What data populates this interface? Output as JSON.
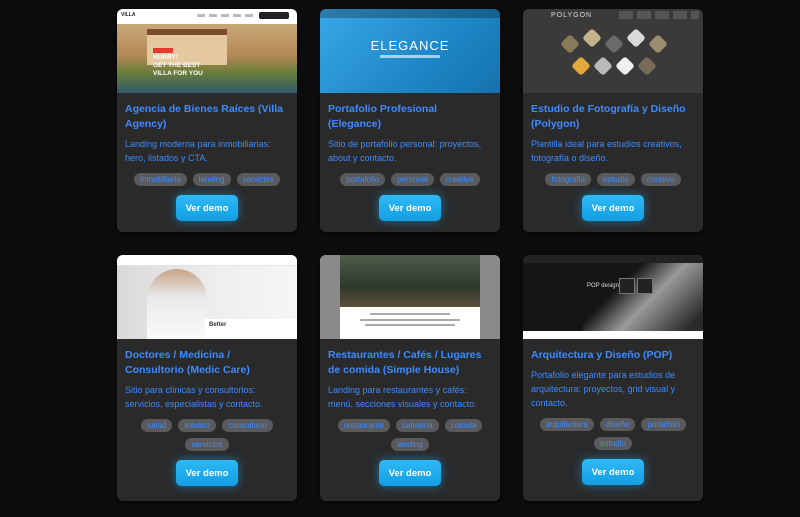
{
  "cards": [
    {
      "title": "Agencia de Bienes Raíces (Villa Agency)",
      "description": "Landing moderna para inmobiliarias: hero, listados y CTA.",
      "tags": [
        "inmobiliaria",
        "landing",
        "servicios"
      ],
      "button": "Ver demo",
      "thumb": {
        "logo": "VILLA",
        "hero_text": "HURRY!\nGET THE BEST\nVILLA FOR YOU"
      }
    },
    {
      "title": "Portafolio Profesional (Elegance)",
      "description": "Sitio de portafolio personal: proyectos, about y contacto.",
      "tags": [
        "portafolio",
        "personal",
        "creativo"
      ],
      "button": "Ver demo",
      "thumb": {
        "hero_text": "ELEGANCE"
      }
    },
    {
      "title": "Estudio de Fotografía y Diseño (Polygon)",
      "description": "Plantilla ideal para estudios creativos, fotografía o diseño.",
      "tags": [
        "fotografia",
        "estudio",
        "creativo"
      ],
      "button": "Ver demo",
      "thumb": {
        "logo": "POLYGON"
      }
    },
    {
      "title": "Doctores / Medicina / Consultorio (Medic Care)",
      "description": "Sitio para clínicas y consultorios: servicios, especialistas y contacto.",
      "tags": [
        "salud",
        "medico",
        "consultorio",
        "servicios"
      ],
      "button": "Ver demo",
      "thumb": {
        "box_text": "Better"
      }
    },
    {
      "title": "Restaurantes / Cafés / Lugares de comida (Simple House)",
      "description": "Landing para restaurantes y cafés: menú, secciones visuales y contacto.",
      "tags": [
        "restaurante",
        "cafeteria",
        "comida",
        "landing"
      ],
      "button": "Ver demo",
      "thumb": {}
    },
    {
      "title": "Arquitectura y Diseño (POP)",
      "description": "Portafolio elegante para estudios de arquitectura: proyectos, grid visual y contacto.",
      "tags": [
        "arquitectura",
        "diseño",
        "portafolio",
        "estudio"
      ],
      "button": "Ver demo",
      "thumb": {
        "hero_text": "POP design"
      }
    }
  ],
  "colors": {
    "background": "#0d0d0d",
    "card": "#2a2a2b",
    "accent_text": "#3d8bff",
    "button": "#1fa9ee",
    "tag_bg": "#5a5a5c"
  }
}
